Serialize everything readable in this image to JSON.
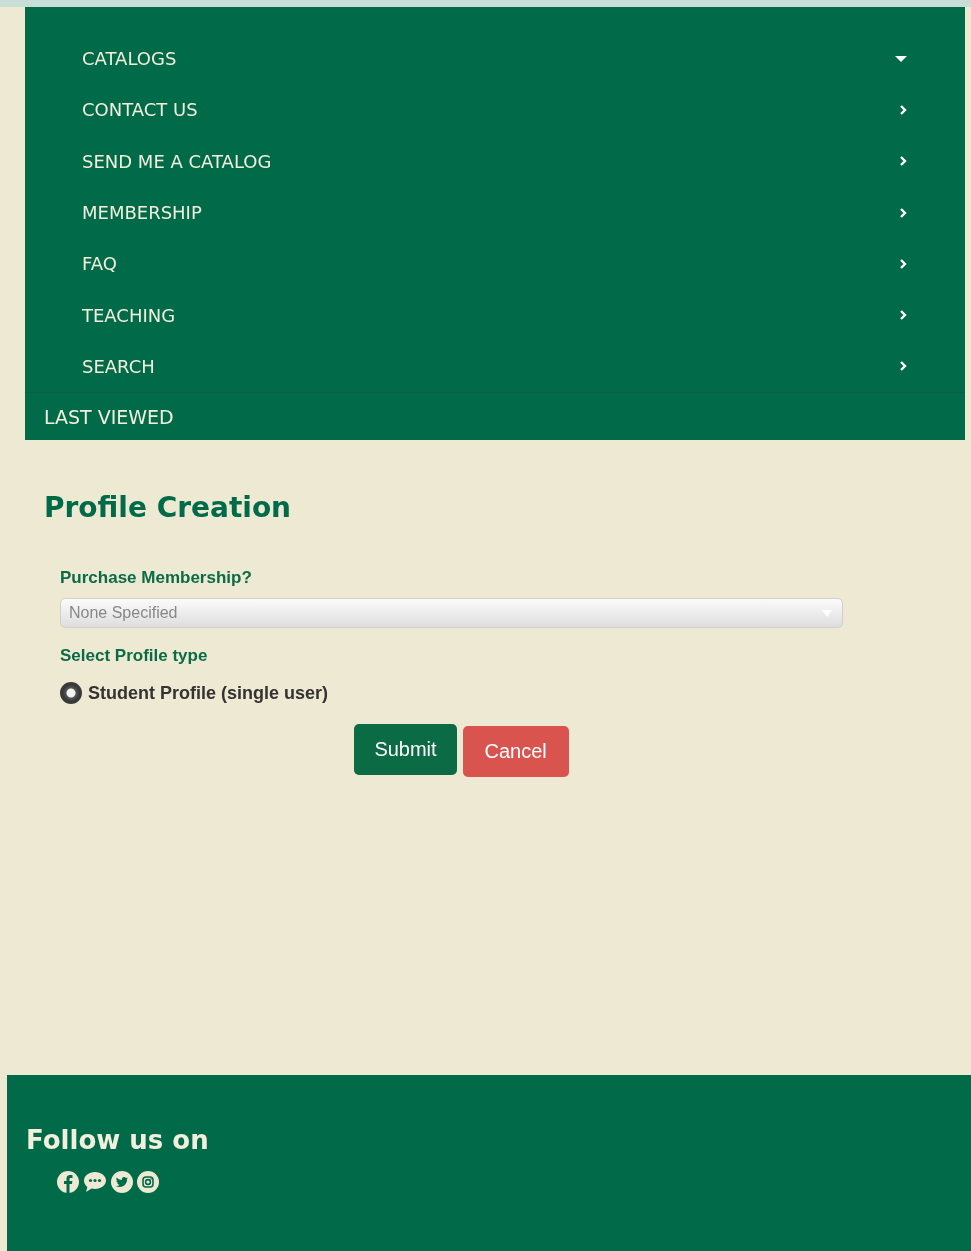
{
  "nav": {
    "items": [
      {
        "label": "CATALOGS",
        "kind": "dropdown"
      },
      {
        "label": "CONTACT US",
        "kind": "link"
      },
      {
        "label": "SEND ME A CATALOG",
        "kind": "link"
      },
      {
        "label": "MEMBERSHIP",
        "kind": "link"
      },
      {
        "label": "FAQ",
        "kind": "link"
      },
      {
        "label": "TEACHING",
        "kind": "link"
      },
      {
        "label": "SEARCH",
        "kind": "link"
      }
    ],
    "last_viewed": "LAST VIEWED"
  },
  "page_title": "Profile Creation",
  "form": {
    "membership_label": "Purchase Membership?",
    "membership_value": "None Specified",
    "profile_type_label": "Select Profile type",
    "options": [
      {
        "label": "Student Profile (single user)",
        "selected": true
      }
    ],
    "buttons": [
      {
        "label": "Submit",
        "kind": "primary"
      },
      {
        "label": "Cancel",
        "kind": "danger"
      }
    ]
  },
  "footer": {
    "heading": "Follow us on",
    "social": [
      {
        "kind": "facebook"
      },
      {
        "kind": "chat"
      },
      {
        "kind": "twitter"
      },
      {
        "kind": "instagram"
      }
    ]
  }
}
